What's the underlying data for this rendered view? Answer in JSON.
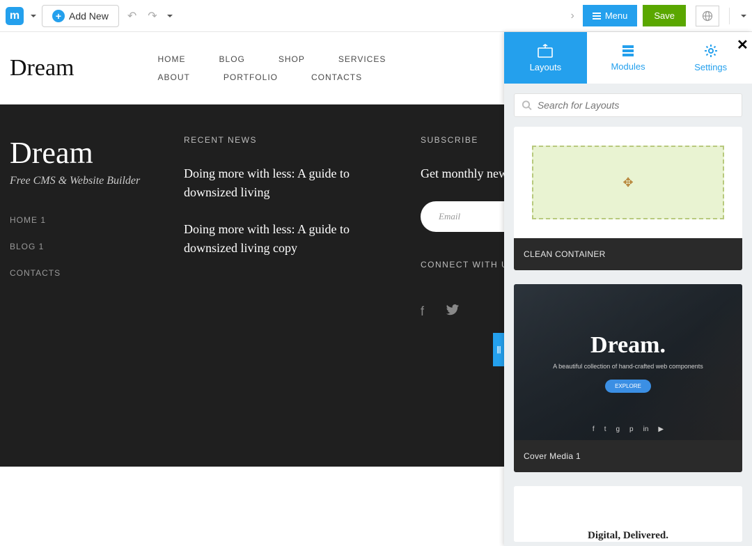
{
  "toolbar": {
    "add_new": "Add New",
    "menu": "Menu",
    "save": "Save"
  },
  "site": {
    "brand": "Dream",
    "nav_row1": [
      "HOME",
      "BLOG",
      "SHOP",
      "SERVICES"
    ],
    "nav_row2": [
      "ABOUT",
      "PORTFOLIO",
      "CONTACTS"
    ]
  },
  "footer": {
    "brand": "Dream",
    "tagline": "Free CMS & Website Builder",
    "links": [
      "HOME 1",
      "BLOG 1",
      "CONTACTS"
    ],
    "recent_head": "RECENT NEWS",
    "news": [
      "Doing more with less: A guide to downsized living",
      "Doing more with less: A guide to downsized living copy"
    ],
    "subscribe_head": "SUBSCRIBE",
    "subscribe_text": "Get monthly newsletter with resources.",
    "email_placeholder": "Email",
    "connect_head": "CONNECT WITH US"
  },
  "panel": {
    "tabs": {
      "layouts": "Layouts",
      "modules": "Modules",
      "settings": "Settings"
    },
    "search_placeholder": "Search for Layouts",
    "cards": {
      "clean": "CLEAN CONTAINER",
      "cover": "Cover Media 1",
      "cover_title": "Dream.",
      "cover_sub": "A beautiful collection of hand-crafted web components",
      "cover_btn": "EXPLORE",
      "digital": "Digital, Delivered."
    }
  }
}
